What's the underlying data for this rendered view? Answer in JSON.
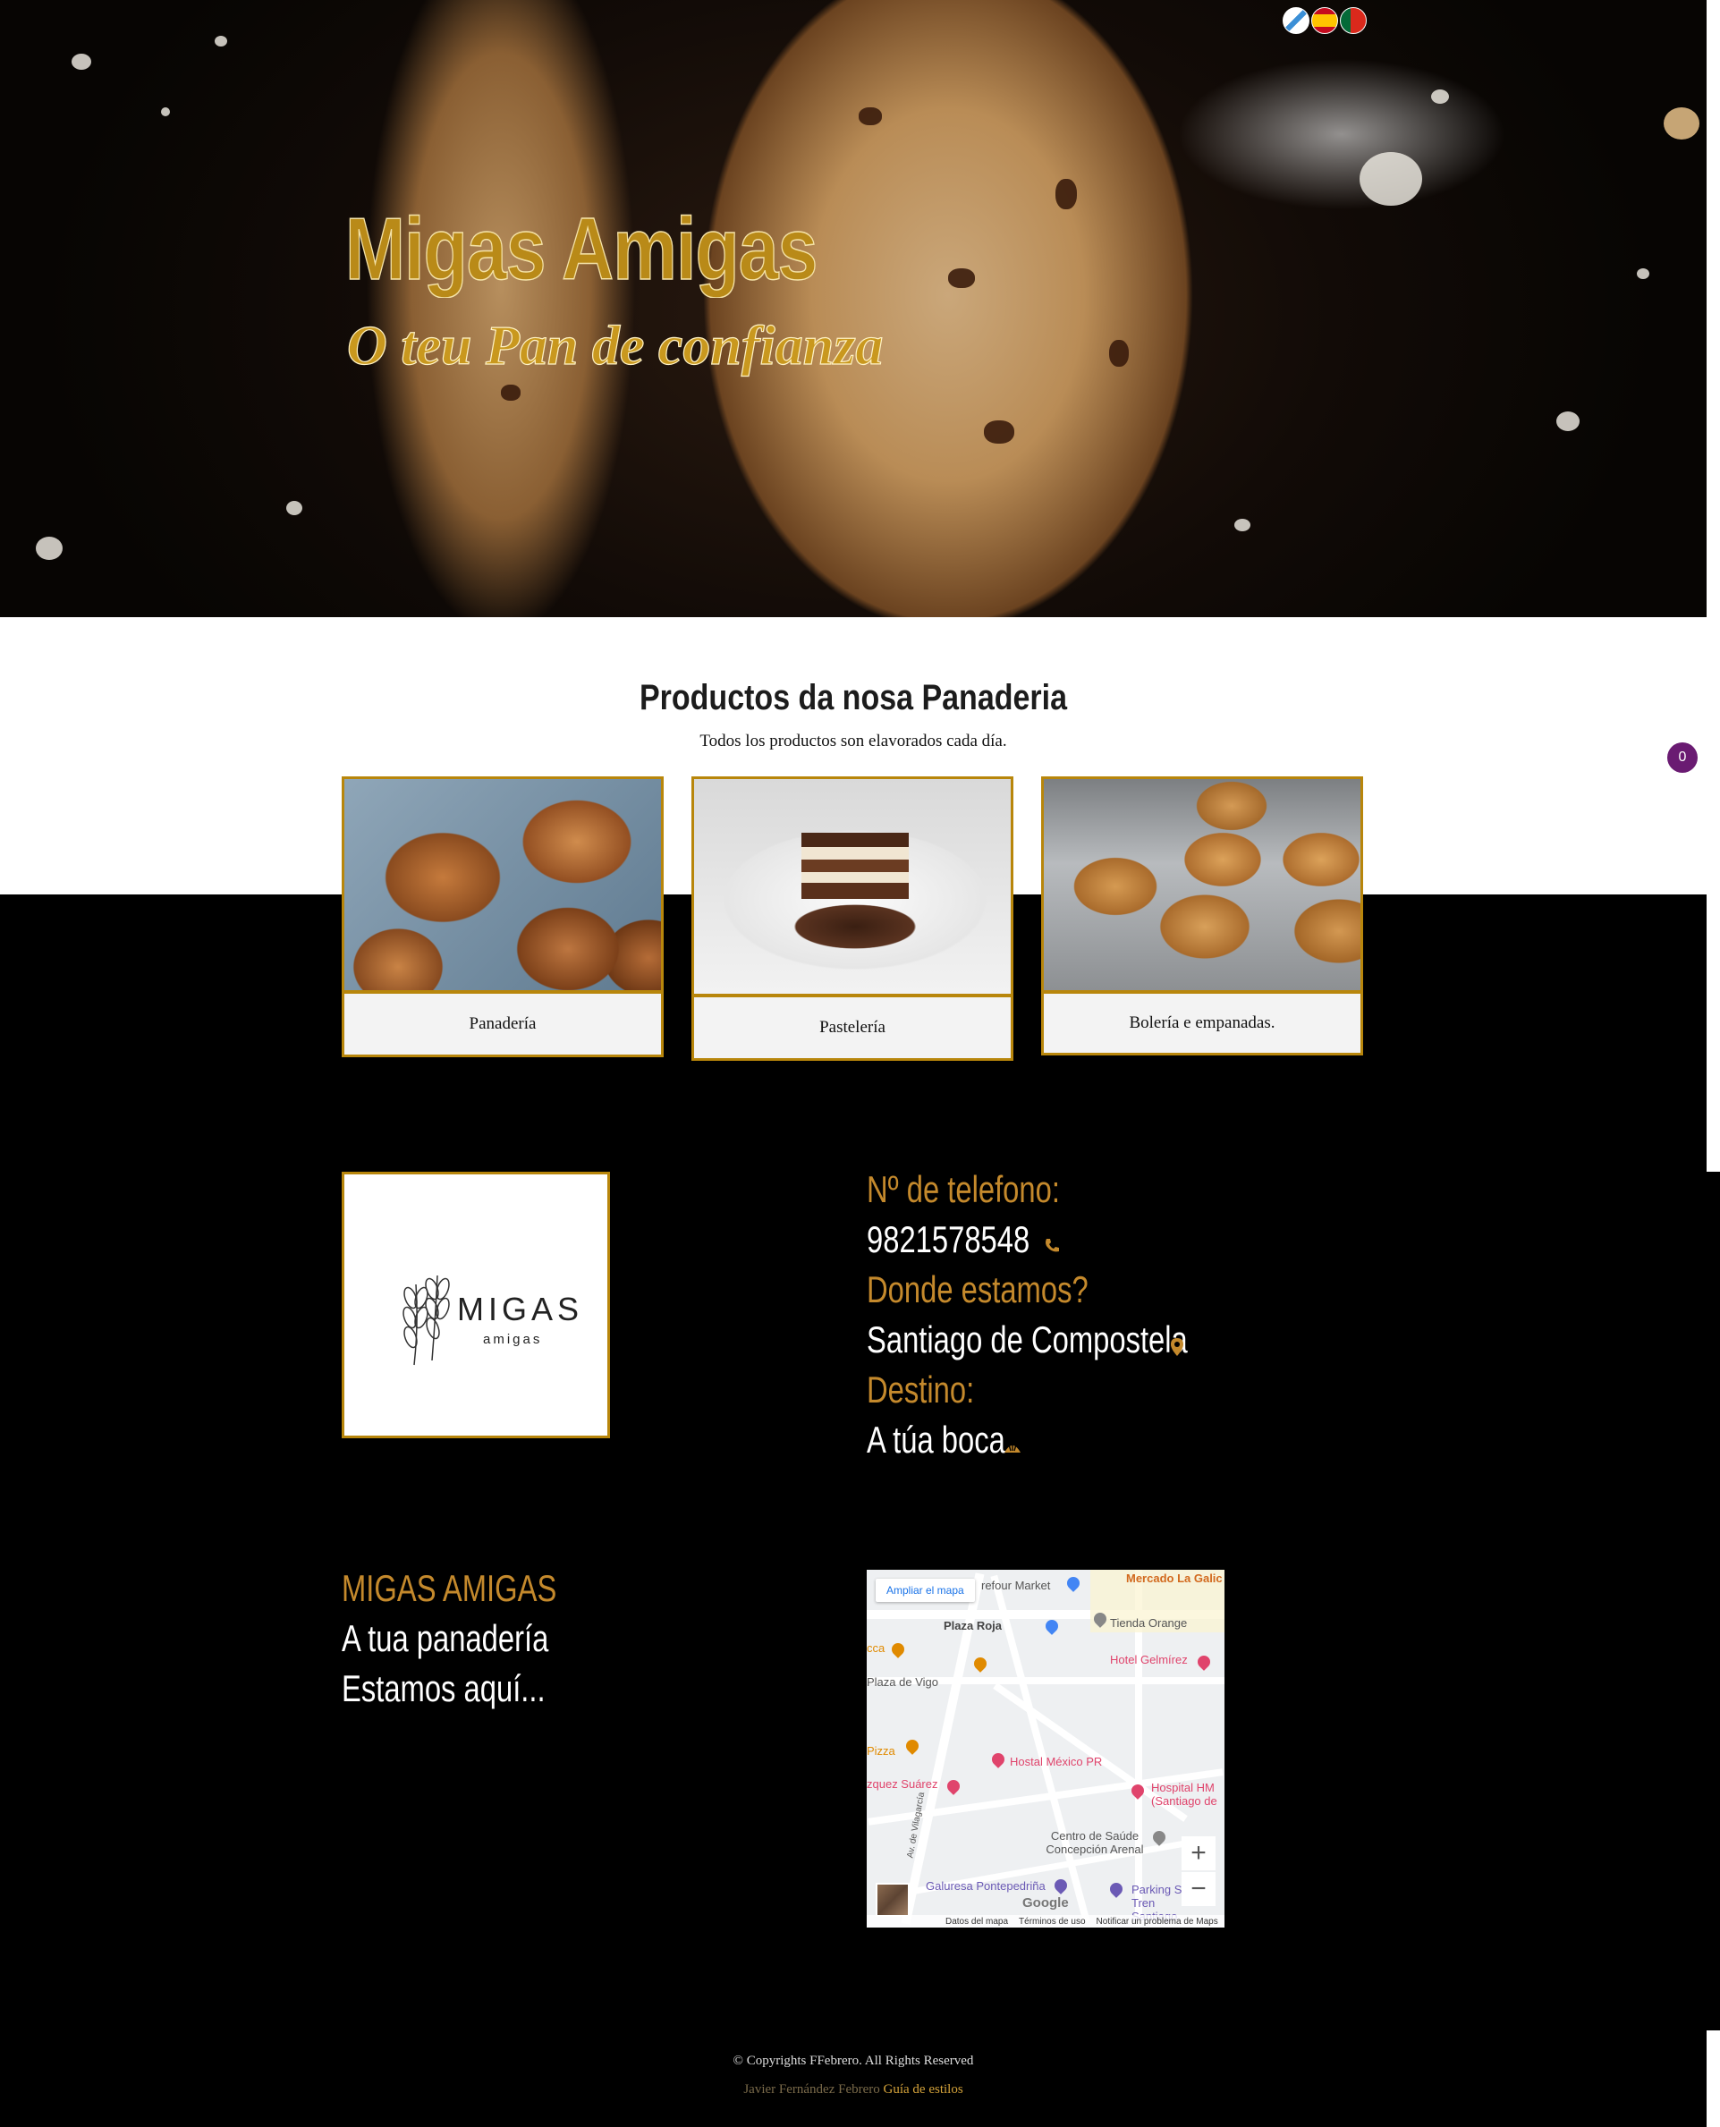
{
  "hero": {
    "title": "Migas Amigas",
    "subtitle": "O teu Pan de confianza",
    "languages": [
      "gl-flag-icon",
      "es-flag-icon",
      "pt-flag-icon"
    ]
  },
  "products": {
    "title": "Productos da nosa Panaderia",
    "subtitle": "Todos los productos son elavorados cada día.",
    "cart_count": "0",
    "items": [
      {
        "label": "Panadería",
        "image": "bread-image"
      },
      {
        "label": "Pastelería",
        "image": "cake-image"
      },
      {
        "label": "Bolería e empanadas.",
        "image": "muffin-image"
      }
    ]
  },
  "logo": {
    "name": "MIGAS",
    "tagline": "amigas"
  },
  "contact": {
    "phone_label": "Nº de telefono:",
    "phone": "9821578548",
    "location_label": "Donde estamos?",
    "location": "Santiago de Compostela",
    "destination_label": "Destino:",
    "destination": "A túa boca"
  },
  "brand": {
    "name": "MIGAS AMIGAS",
    "line1": "A tua panadería",
    "line2": "Estamos aquí..."
  },
  "map": {
    "enlarge": "Ampliar el mapa",
    "labels": [
      "refour Market",
      "Mercado La Galic",
      "Plaza Roja",
      "Tienda Orange",
      "Hotel Gelmírez",
      "cca",
      "Plaza de Vigo",
      "Pizza",
      "Hostal México PR",
      "zquez Suárez",
      "Hospital HM (Santiago de",
      "Centro de Saúde Concepción Arenal",
      "Av. de Vilagarcía",
      "Galuresa Pontepedriña",
      "Parking S Tren Santiago"
    ],
    "zoom_in": "+",
    "zoom_out": "−",
    "google": "Google",
    "footer": [
      "Datos del mapa",
      "Términos de uso",
      "Notificar un problema de Maps"
    ]
  },
  "footer": {
    "copyright": "© Copyrights FFebrero. All Rights Reserved",
    "author": "Javier Fernández Febrero",
    "style_guide": "Guía de estilos"
  },
  "colors": {
    "gold": "#b8860b",
    "accent_text": "#c4892c",
    "badge": "#6a1b72"
  }
}
